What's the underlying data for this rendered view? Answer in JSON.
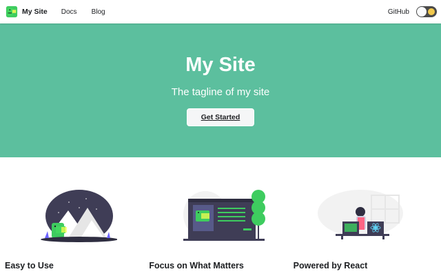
{
  "navbar": {
    "brand_title": "My Site",
    "links": [
      "Docs",
      "Blog"
    ],
    "github_label": "GitHub",
    "logo_icon": "dinosaur-logo-icon",
    "theme_toggle_icon": "dark-mode-toggle"
  },
  "hero": {
    "title": "My Site",
    "tagline": "The tagline of my site",
    "cta_label": "Get Started"
  },
  "features": [
    {
      "title": "Easy to Use",
      "illustration": "mountain-dinosaur-illustration"
    },
    {
      "title": "Focus on What Matters",
      "illustration": "browser-tree-illustration"
    },
    {
      "title": "Powered by React",
      "illustration": "react-desk-illustration"
    }
  ],
  "colors": {
    "primary": "#5cbf9e",
    "text": "#1c1e21",
    "button_bg": "#f5f6f7"
  }
}
